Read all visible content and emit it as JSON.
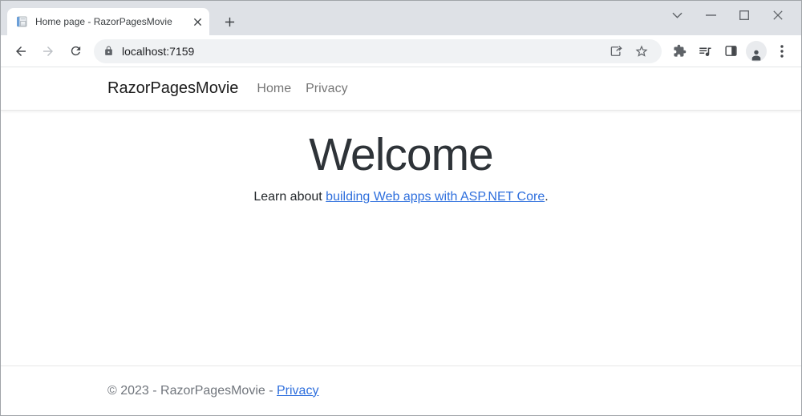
{
  "browser": {
    "tab_title": "Home page - RazorPagesMovie",
    "url": "localhost:7159",
    "icons": {
      "favicon": "aspnet-document-icon",
      "tab_close": "close-x",
      "new_tab": "plus",
      "tab_search": "chevron-down",
      "window_minimize": "horizontal-line",
      "window_maximize": "square-outline",
      "window_close": "close-x",
      "back": "left-arrow",
      "forward": "right-arrow",
      "reload": "circular-arrow",
      "site_security": "padlock",
      "share": "arrow-out-of-box",
      "bookmark": "star-outline",
      "extensions": "puzzle-piece",
      "media_controls": "playlist-with-note",
      "side_panel": "split-square",
      "profile": "person-silhouette",
      "menu": "three-vertical-dots"
    }
  },
  "page": {
    "navbar": {
      "brand": "RazorPagesMovie",
      "links": [
        {
          "label": "Home"
        },
        {
          "label": "Privacy"
        }
      ]
    },
    "main": {
      "heading": "Welcome",
      "intro_prefix": "Learn about ",
      "intro_link": "building Web apps with ASP.NET Core",
      "intro_suffix": "."
    },
    "footer": {
      "copyright_prefix": "© 2023 - RazorPagesMovie - ",
      "privacy_link": "Privacy"
    }
  },
  "colors": {
    "link_blue": "#2e6fdd",
    "tabstrip_bg": "#dee1e6",
    "toolbar_bg": "#ffffff",
    "omnibox_bg": "#f0f2f4",
    "icon_gray": "#5f6368",
    "navbar_border": "#e7e7e7",
    "footer_text": "#70757c",
    "favicon_blue": "#6b9fd8"
  }
}
